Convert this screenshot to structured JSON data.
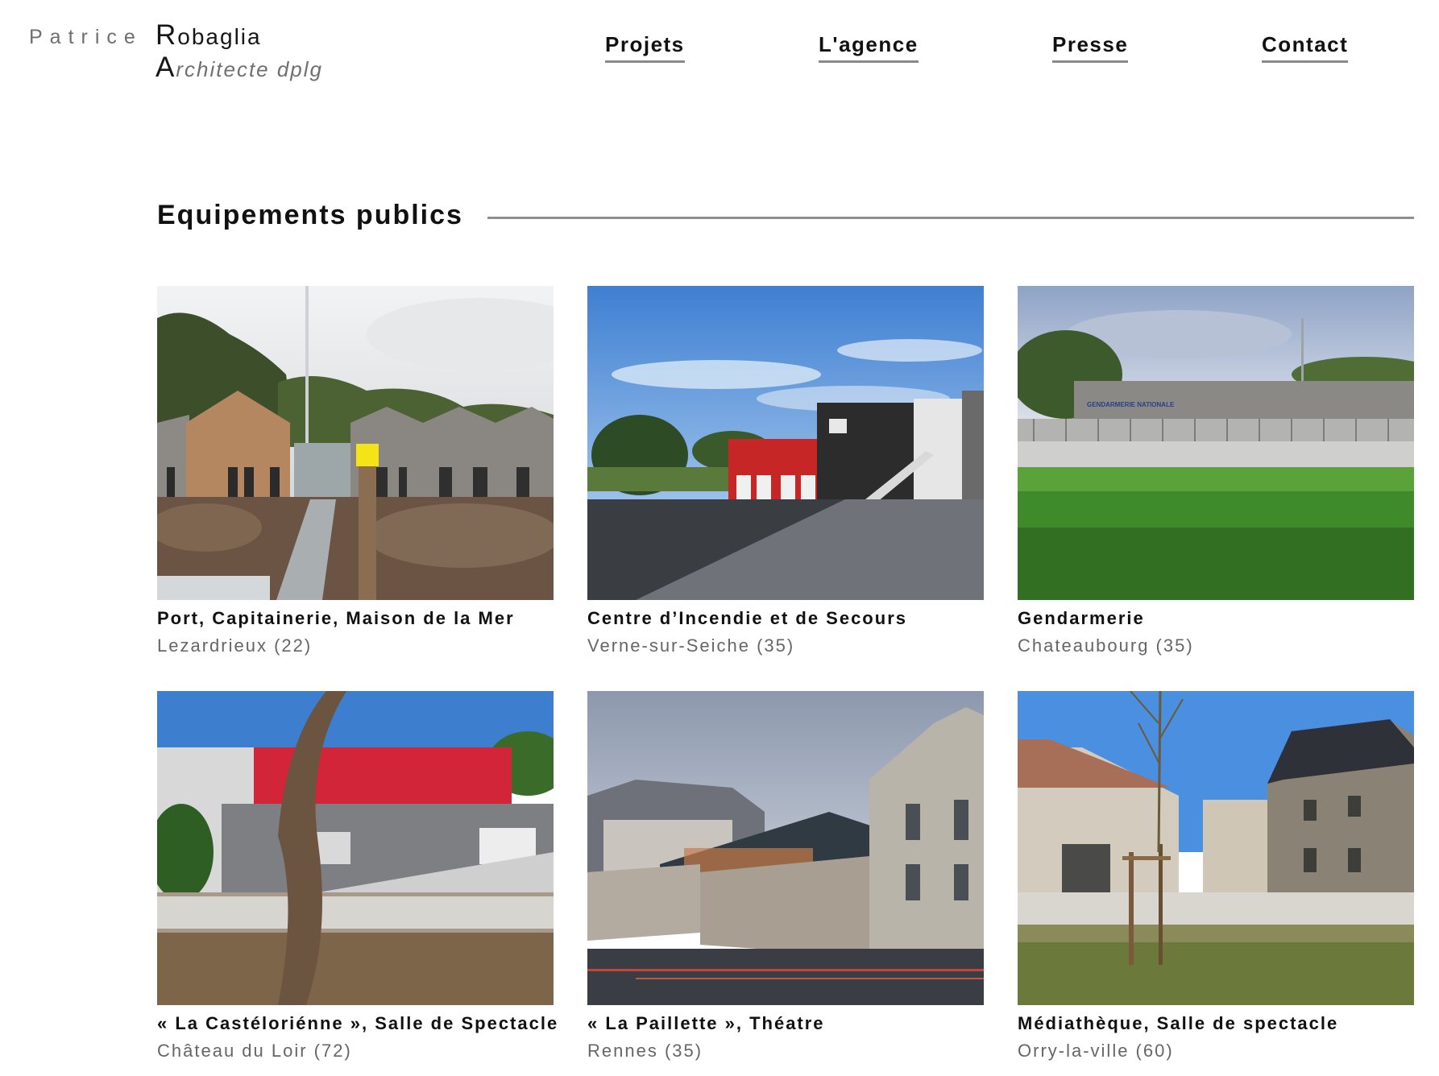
{
  "brand": {
    "first_name": "Patrice",
    "last_initial": "R",
    "last_rest": "obaglia",
    "role_initial": "A",
    "role_rest": "rchitecte dplg"
  },
  "nav": {
    "items": [
      "Projets",
      "L'agence",
      "Presse",
      "Contact"
    ]
  },
  "section": {
    "title": "Equipements publics"
  },
  "projects": [
    {
      "title": "Port, Capitainerie, Maison de la Mer",
      "place": "Lezardrieux (22)"
    },
    {
      "title": "Centre d’Incendie et de Secours",
      "place": "Verne-sur-Seiche (35)"
    },
    {
      "title": "Gendarmerie",
      "place": "Chateaubourg (35)",
      "sign_text": "GENDARMERIE NATIONALE"
    },
    {
      "title": "« La Castéloriénne », Salle de Spectacle",
      "place": "Château du Loir (72)"
    },
    {
      "title": "« La Paillette », Théatre",
      "place": "Rennes (35)"
    },
    {
      "title": "Médiathèque, Salle de spectacle",
      "place": "Orry-la-ville (60)"
    }
  ],
  "colors": {
    "text": "#111111",
    "muted": "#666666",
    "rule": "#8f8f8f",
    "fire_station_red": "#c62626",
    "theatre_red": "#d2253a"
  }
}
